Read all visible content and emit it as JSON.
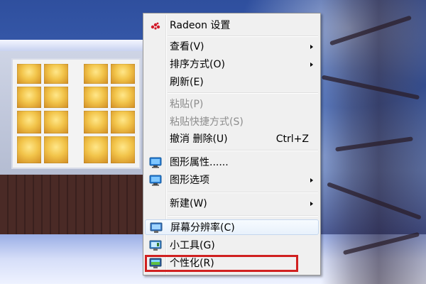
{
  "context_menu": {
    "items": [
      {
        "label": "Radeon 设置",
        "icon": "radeon-icon"
      },
      {
        "label": "查看(V)",
        "submenu": true
      },
      {
        "label": "排序方式(O)",
        "submenu": true
      },
      {
        "label": "刷新(E)"
      },
      {
        "label": "粘贴(P)",
        "disabled": true
      },
      {
        "label": "粘贴快捷方式(S)",
        "disabled": true
      },
      {
        "label": "撤消 删除(U)",
        "shortcut": "Ctrl+Z"
      },
      {
        "label": "图形属性......",
        "icon": "graphics-properties-icon"
      },
      {
        "label": "图形选项",
        "icon": "graphics-options-icon",
        "submenu": true
      },
      {
        "label": "新建(W)",
        "submenu": true
      },
      {
        "label": "屏幕分辨率(C)",
        "icon": "screen-resolution-icon",
        "hovered": true
      },
      {
        "label": "小工具(G)",
        "icon": "gadgets-icon"
      },
      {
        "label": "个性化(R)",
        "icon": "personalize-icon",
        "highlighted": true
      }
    ]
  },
  "colors": {
    "menu_bg": "#f0f0f0",
    "highlight_box": "#d02020",
    "disabled_text": "#8d8d8d"
  }
}
